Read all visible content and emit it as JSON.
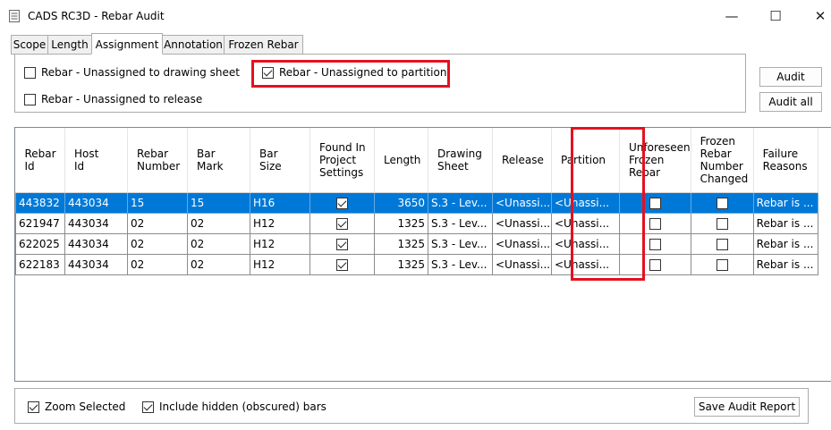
{
  "window": {
    "title": "CADS RC3D - Rebar Audit",
    "minimize": "—",
    "maximize": "☐",
    "close": "✕",
    "icon": "document-icon"
  },
  "tabs": [
    {
      "label": "Scope",
      "active": false
    },
    {
      "label": "Length",
      "active": false
    },
    {
      "label": "Assignment",
      "active": true
    },
    {
      "label": "Annotation",
      "active": false
    },
    {
      "label": "Frozen Rebar",
      "active": false
    }
  ],
  "options": {
    "unassigned_drawing": {
      "label": "Rebar - Unassigned to drawing sheet",
      "checked": false
    },
    "unassigned_partition": {
      "label": "Rebar - Unassigned to partition",
      "checked": true
    },
    "unassigned_release": {
      "label": "Rebar - Unassigned to release",
      "checked": false
    }
  },
  "buttons": {
    "audit": "Audit",
    "audit_all": "Audit all",
    "save_report": "Save Audit Report"
  },
  "grid": {
    "columns": [
      [
        "Rebar",
        "Id"
      ],
      [
        "Host",
        "Id"
      ],
      [
        "Rebar",
        "Number"
      ],
      [
        "Bar",
        "Mark"
      ],
      [
        "Bar",
        "Size"
      ],
      [
        "Found In",
        "Project",
        "Settings"
      ],
      [
        "Length"
      ],
      [
        "Drawing",
        "Sheet"
      ],
      [
        "Release"
      ],
      [
        "Partition"
      ],
      [
        "Unforeseen",
        "Frozen",
        "Rebar"
      ],
      [
        "Frozen",
        "Rebar",
        "Number",
        "Changed"
      ],
      [
        "Failure",
        "Reasons"
      ]
    ],
    "rows": [
      {
        "id": "443832",
        "host": "443034",
        "number": "15",
        "mark": "15",
        "size": "H16",
        "found": true,
        "length": "3650",
        "sheet": "S.3 - Lev...",
        "release": "<Unassi...",
        "partition": "<Unassi...",
        "unforeseen": false,
        "changed": false,
        "reasons": "Rebar is ...",
        "selected": true
      },
      {
        "id": "621947",
        "host": "443034",
        "number": "02",
        "mark": "02",
        "size": "H12",
        "found": true,
        "length": "1325",
        "sheet": "S.3 - Lev...",
        "release": "<Unassi...",
        "partition": "<Unassi...",
        "unforeseen": false,
        "changed": false,
        "reasons": "Rebar is ...",
        "selected": false
      },
      {
        "id": "622025",
        "host": "443034",
        "number": "02",
        "mark": "02",
        "size": "H12",
        "found": true,
        "length": "1325",
        "sheet": "S.3 - Lev...",
        "release": "<Unassi...",
        "partition": "<Unassi...",
        "unforeseen": false,
        "changed": false,
        "reasons": "Rebar is ...",
        "selected": false
      },
      {
        "id": "622183",
        "host": "443034",
        "number": "02",
        "mark": "02",
        "size": "H12",
        "found": true,
        "length": "1325",
        "sheet": "S.3 - Lev...",
        "release": "<Unassi...",
        "partition": "<Unassi...",
        "unforeseen": false,
        "changed": false,
        "reasons": "Rebar is ...",
        "selected": false
      }
    ]
  },
  "bottom": {
    "zoom_selected": {
      "label": "Zoom Selected",
      "checked": true
    },
    "include_hidden": {
      "label": "Include hidden (obscured) bars",
      "checked": true
    }
  },
  "colors": {
    "highlight": "#e3121f",
    "selection": "#0078d7"
  }
}
